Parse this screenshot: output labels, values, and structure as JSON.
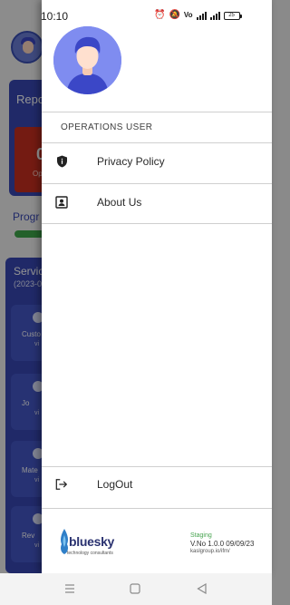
{
  "status_bar": {
    "time": "10:10",
    "battery": "25"
  },
  "background": {
    "report_title": "Repo",
    "report_count": "0",
    "report_sub": "Op",
    "progress_label": "Progr",
    "service_title": "Servic",
    "service_sub": "(2023-0",
    "tiles": [
      {
        "label": "Custo",
        "sub": "vi"
      },
      {
        "label": "Jo",
        "sub": "vi"
      },
      {
        "label": "Mate",
        "sub": "vi"
      },
      {
        "label": "Rev",
        "sub": "vi"
      }
    ]
  },
  "drawer": {
    "role": "OPERATIONS USER",
    "menu": [
      {
        "label": "Privacy Policy",
        "icon": "shield-icon"
      },
      {
        "label": "About Us",
        "icon": "contact-card-icon"
      }
    ],
    "logout_label": "LogOut",
    "brand": {
      "name": "bluesky",
      "tagline": "technology consultants"
    },
    "environment": "Staging",
    "version": "V.No 1.0.0 09/09/23",
    "url": "kaslgroup.io/ifm/"
  },
  "colors": {
    "accent": "#3747b3",
    "staging": "#47a450",
    "avatar_bg": "#7f8cf0"
  }
}
